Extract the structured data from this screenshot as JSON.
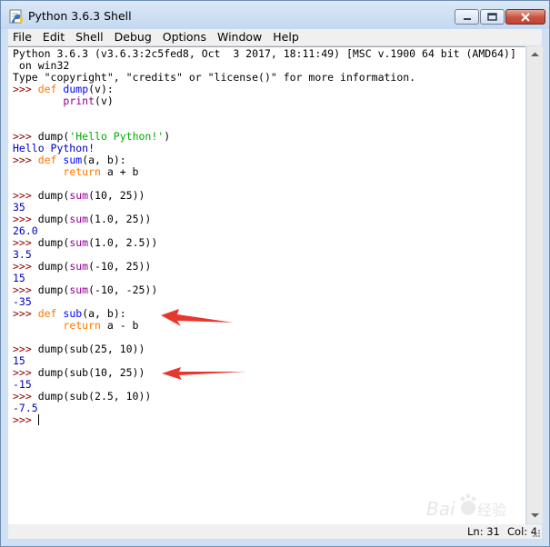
{
  "window": {
    "title": "Python 3.6.3 Shell",
    "icons": {
      "app": "python-idle-icon",
      "minimize": "minimize-icon",
      "maximize": "maximize-icon",
      "close": "close-icon"
    }
  },
  "menu": [
    "File",
    "Edit",
    "Shell",
    "Debug",
    "Options",
    "Window",
    "Help"
  ],
  "colors": {
    "prompt": "#8b0000",
    "keyword": "#ff7700",
    "definition": "#0000ff",
    "builtin": "#900090",
    "string": "#00aa00",
    "output": "#0000c0",
    "annotation_arrow": "#e8372e"
  },
  "shell": {
    "lines": [
      [
        {
          "t": "Python 3.6.3 (v3.6.3:2c5fed8, Oct  3 2017, 18:11:49) [MSC v.1900 64 bit (AMD64)]",
          "c": ""
        }
      ],
      [
        {
          "t": " on win32",
          "c": ""
        }
      ],
      [
        {
          "t": "Type \"copyright\", \"credits\" or \"license()\" for more information.",
          "c": ""
        }
      ],
      [
        {
          "t": ">>> ",
          "c": "prompt"
        },
        {
          "t": "def",
          "c": "kw"
        },
        {
          "t": " ",
          "c": ""
        },
        {
          "t": "dump",
          "c": "def"
        },
        {
          "t": "(v):",
          "c": ""
        }
      ],
      [
        {
          "t": "        ",
          "c": ""
        },
        {
          "t": "print",
          "c": "builtin"
        },
        {
          "t": "(v)",
          "c": ""
        }
      ],
      [],
      [],
      [
        {
          "t": ">>> ",
          "c": "prompt"
        },
        {
          "t": "dump(",
          "c": ""
        },
        {
          "t": "'Hello Python!'",
          "c": "str"
        },
        {
          "t": ")",
          "c": ""
        }
      ],
      [
        {
          "t": "Hello Python!",
          "c": "out"
        }
      ],
      [
        {
          "t": ">>> ",
          "c": "prompt"
        },
        {
          "t": "def",
          "c": "kw"
        },
        {
          "t": " ",
          "c": ""
        },
        {
          "t": "sum",
          "c": "def"
        },
        {
          "t": "(a, b):",
          "c": ""
        }
      ],
      [
        {
          "t": "        ",
          "c": ""
        },
        {
          "t": "return",
          "c": "kw"
        },
        {
          "t": " a + b",
          "c": ""
        }
      ],
      [],
      [
        {
          "t": ">>> ",
          "c": "prompt"
        },
        {
          "t": "dump(",
          "c": ""
        },
        {
          "t": "sum",
          "c": "builtin"
        },
        {
          "t": "(10, 25))",
          "c": ""
        }
      ],
      [
        {
          "t": "35",
          "c": "out"
        }
      ],
      [
        {
          "t": ">>> ",
          "c": "prompt"
        },
        {
          "t": "dump(",
          "c": ""
        },
        {
          "t": "sum",
          "c": "builtin"
        },
        {
          "t": "(1.0, 25))",
          "c": ""
        }
      ],
      [
        {
          "t": "26.0",
          "c": "out"
        }
      ],
      [
        {
          "t": ">>> ",
          "c": "prompt"
        },
        {
          "t": "dump(",
          "c": ""
        },
        {
          "t": "sum",
          "c": "builtin"
        },
        {
          "t": "(1.0, 2.5))",
          "c": ""
        }
      ],
      [
        {
          "t": "3.5",
          "c": "out"
        }
      ],
      [
        {
          "t": ">>> ",
          "c": "prompt"
        },
        {
          "t": "dump(",
          "c": ""
        },
        {
          "t": "sum",
          "c": "builtin"
        },
        {
          "t": "(-10, 25))",
          "c": ""
        }
      ],
      [
        {
          "t": "15",
          "c": "out"
        }
      ],
      [
        {
          "t": ">>> ",
          "c": "prompt"
        },
        {
          "t": "dump(",
          "c": ""
        },
        {
          "t": "sum",
          "c": "builtin"
        },
        {
          "t": "(-10, -25))",
          "c": ""
        }
      ],
      [
        {
          "t": "-35",
          "c": "out"
        }
      ],
      [
        {
          "t": ">>> ",
          "c": "prompt"
        },
        {
          "t": "def",
          "c": "kw"
        },
        {
          "t": " ",
          "c": ""
        },
        {
          "t": "sub",
          "c": "def"
        },
        {
          "t": "(a, b):",
          "c": ""
        }
      ],
      [
        {
          "t": "        ",
          "c": ""
        },
        {
          "t": "return",
          "c": "kw"
        },
        {
          "t": " a - b",
          "c": ""
        }
      ],
      [],
      [
        {
          "t": ">>> ",
          "c": "prompt"
        },
        {
          "t": "dump(sub(25, 10))",
          "c": ""
        }
      ],
      [
        {
          "t": "15",
          "c": "out"
        }
      ],
      [
        {
          "t": ">>> ",
          "c": "prompt"
        },
        {
          "t": "dump(sub(10, 25))",
          "c": ""
        }
      ],
      [
        {
          "t": "-15",
          "c": "out"
        }
      ],
      [
        {
          "t": ">>> ",
          "c": "prompt"
        },
        {
          "t": "dump(sub(2.5, 10))",
          "c": ""
        }
      ],
      [
        {
          "t": "-7.5",
          "c": "out"
        }
      ],
      [
        {
          "t": ">>> ",
          "c": "prompt"
        }
      ]
    ]
  },
  "status": {
    "line": "Ln: 31",
    "col": "Col: 4"
  },
  "annotations": [
    {
      "name": "arrow-to-def-sub",
      "target_line": 23,
      "icon": "red-arrow-icon"
    },
    {
      "name": "arrow-to-negative-result",
      "target_line": 28,
      "icon": "red-arrow-icon"
    }
  ],
  "watermark": {
    "text": "Baidu 经验",
    "icon": "baidu-paw-logo"
  }
}
